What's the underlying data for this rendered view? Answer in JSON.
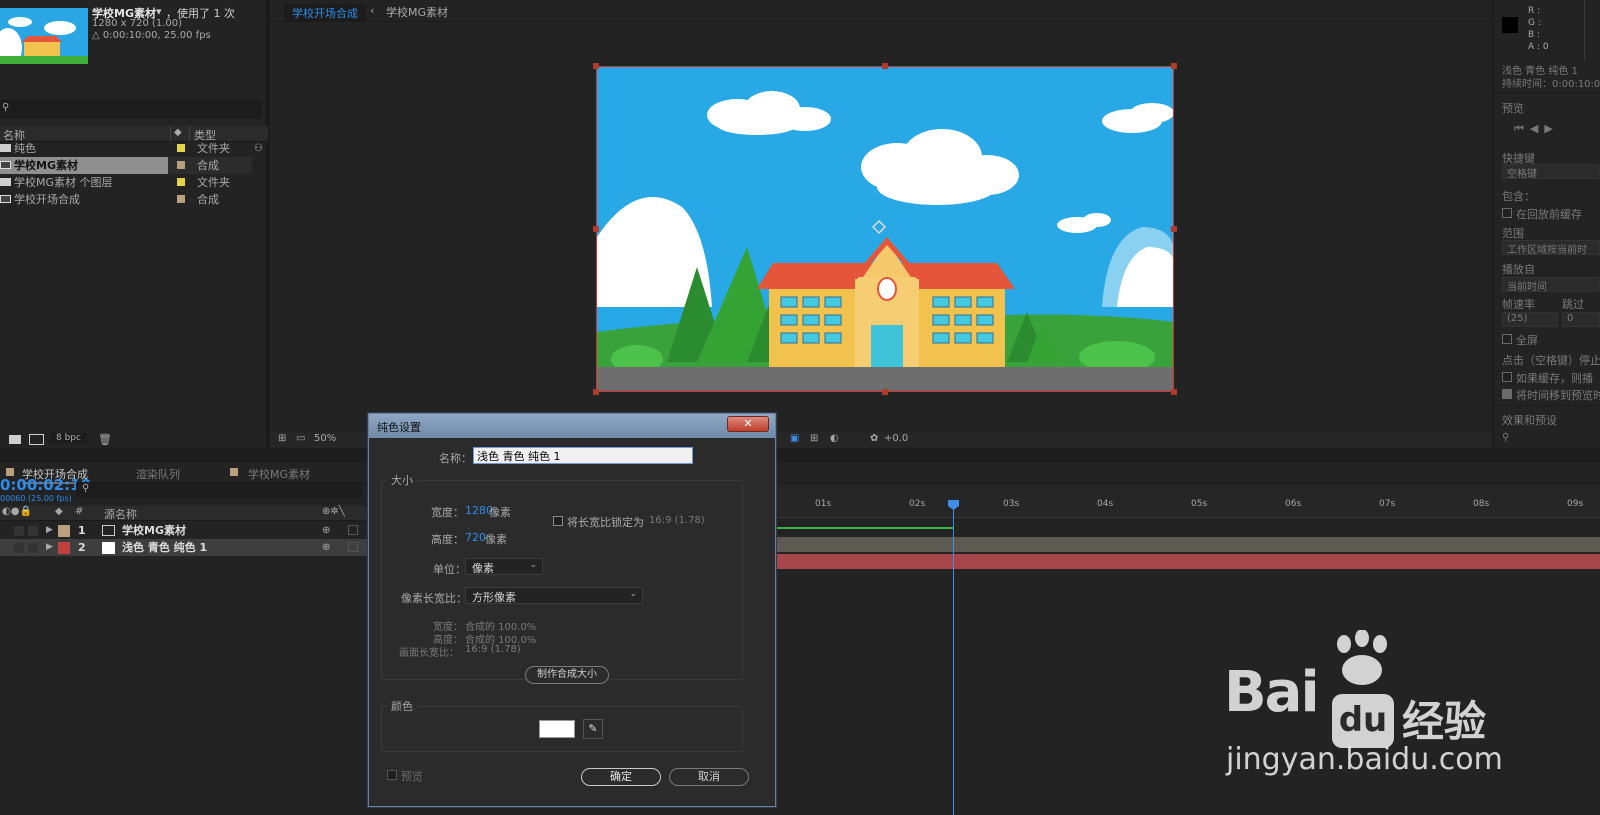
{
  "project": {
    "item_name": "学校MG素材",
    "usage": "，使用了 1 次",
    "dims": "1280 x 720 (1.00)",
    "duration": "△ 0:00:10:00, 25.00 fps",
    "col_name": "名称",
    "col_type": "类型",
    "items": [
      {
        "name": "纯色",
        "type": "文件夹",
        "color": "#e6d34a"
      },
      {
        "name": "学校MG素材",
        "type": "合成",
        "color": "#b8a07c"
      },
      {
        "name": "学校MG素材 个图层",
        "type": "文件夹",
        "color": "#e6d34a"
      },
      {
        "name": "学校开场合成",
        "type": "合成",
        "color": "#b8a07c"
      }
    ],
    "bpc": "8 bpc"
  },
  "comp": {
    "tabs": [
      "学校开场合成",
      "学校MG素材"
    ],
    "zoom": "50%",
    "exposure": "+0.0"
  },
  "right_panel": {
    "rgba": [
      "R :",
      "G :",
      "B :",
      "A : 0"
    ],
    "layer_name": "浅色 青色 纯色 1",
    "duration_label": "持续时间：0:00:10:00",
    "preview_title": "预览",
    "shortcut": "快捷键",
    "shortcut_value": "空格键",
    "include": "包含：",
    "cache_bg": "在回放前缓存",
    "range": "范围",
    "range_value": "工作区域按当前时",
    "play_from": "播放自",
    "play_from_value": "当前时间",
    "frame_rate": "帧速率",
    "skip": "跳过",
    "frame_rate_value": "(25)",
    "skip_value": "0",
    "fullscreen": "全屏",
    "click_stop": "点击（空格键）停止：",
    "if_cached": "如果缓存，则播",
    "move_time": "将时间移到预览时",
    "effects": "效果和预设"
  },
  "timeline": {
    "tabs": [
      "学校开场合成",
      "渲染队列",
      "学校MG素材"
    ],
    "timecode": "0:00:02:10",
    "frames": "00060 (25.00 fps)",
    "col_source": "源名称",
    "layers": [
      {
        "num": "1",
        "name": "学校MG素材",
        "color": "#b8a07c"
      },
      {
        "num": "2",
        "name": "浅色 青色 纯色 1",
        "color": "#c0413d"
      }
    ],
    "ruler": [
      "01s",
      "02s",
      "03s",
      "04s",
      "05s",
      "06s",
      "07s",
      "08s",
      "09s"
    ],
    "playhead_seconds": 2.4
  },
  "dialog": {
    "title": "纯色设置",
    "close": "✕",
    "name_label": "名称：",
    "name_value": "浅色 青色 纯色 1",
    "size_title": "大小",
    "width_label": "宽度：",
    "width_value": "1280",
    "height_label": "高度：",
    "height_value": "720",
    "px": "像素",
    "lock_label": "将长宽比锁定为",
    "lock_value": "16:9 (1.78)",
    "unit_label": "单位：",
    "unit_value": "像素",
    "par_label": "像素长宽比：",
    "par_value": "方形像素",
    "comp_width": "宽度：",
    "comp_width_value": "合成的 100.0%",
    "comp_height": "高度：",
    "comp_height_value": "合成的 100.0%",
    "frame_aspect": "画面长宽比：",
    "frame_aspect_value": "16:9 (1.78)",
    "make_comp_size": "制作合成大小",
    "color_title": "颜色",
    "color_value": "#ffffff",
    "preview": "预览",
    "ok": "确定",
    "cancel": "取消"
  },
  "watermark": {
    "brand": "Bai",
    "du": "du",
    "jingyan": "经验",
    "url": "jingyan.baidu.com"
  }
}
